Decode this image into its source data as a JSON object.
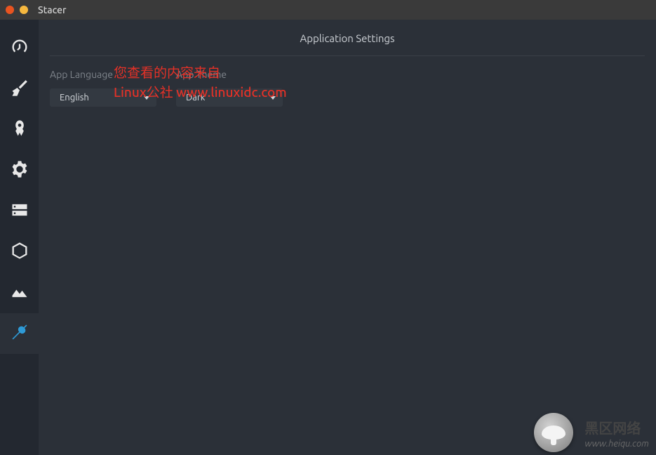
{
  "titlebar": {
    "title": "Stacer"
  },
  "page": {
    "title": "Application Settings"
  },
  "settings": {
    "language": {
      "label": "App Language",
      "value": "English"
    },
    "theme": {
      "label": "App Theme",
      "value": "Dark"
    }
  },
  "watermark_overlay": {
    "line1": "您查看的内容来自",
    "line2": "Linux公社 www.linuxidc.com"
  },
  "corner_watermark": {
    "cn": "黑区网络",
    "url": "www.heiqu.com"
  },
  "sidebar": {
    "items": [
      {
        "name": "dashboard-icon"
      },
      {
        "name": "cleaner-icon"
      },
      {
        "name": "startup-icon"
      },
      {
        "name": "services-icon"
      },
      {
        "name": "processes-icon"
      },
      {
        "name": "packages-icon"
      },
      {
        "name": "resources-icon"
      },
      {
        "name": "settings-icon"
      }
    ],
    "active_index": 7
  }
}
